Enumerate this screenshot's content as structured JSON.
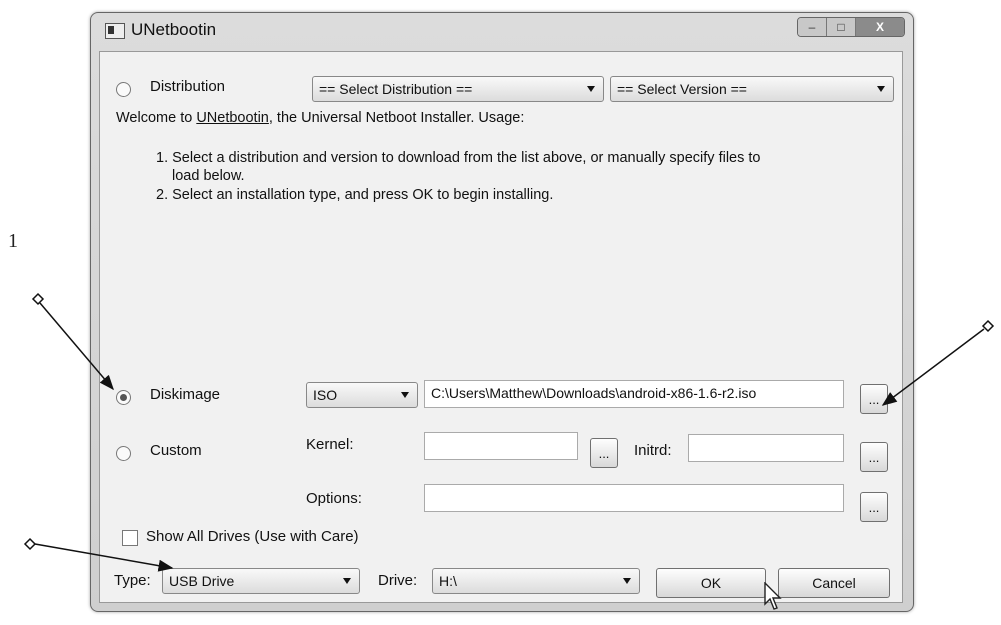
{
  "page_marker": "1",
  "window": {
    "title": "UNetbootin",
    "controls": {
      "minimize": "–",
      "maximize": "□",
      "close": "X"
    }
  },
  "distribution": {
    "radio_label": "Distribution",
    "select_distribution": "== Select Distribution ==",
    "select_version": "== Select Version =="
  },
  "instructions": {
    "welcome_prefix": "Welcome to ",
    "welcome_link": "UNetbootin",
    "welcome_suffix": ", the Universal Netboot Installer. Usage:",
    "step1": "1. Select a distribution and version to download from the list above, or manually specify files to",
    "step1_cont": "load below.",
    "step2": "2. Select an installation type, and press OK to begin installing."
  },
  "diskimage": {
    "radio_label": "Diskimage",
    "type_value": "ISO",
    "path_value": "C:\\Users\\Matthew\\Downloads\\android-x86-1.6-r2.iso",
    "browse_label": "..."
  },
  "custom": {
    "radio_label": "Custom",
    "kernel_label": "Kernel:",
    "kernel_value": "",
    "kernel_browse": "...",
    "initrd_label": "Initrd:",
    "initrd_value": "",
    "initrd_browse": "...",
    "options_label": "Options:",
    "options_value": "",
    "options_browse": "..."
  },
  "show_all_drives": {
    "label": "Show All Drives (Use with Care)"
  },
  "bottom": {
    "type_label": "Type:",
    "type_value": "USB Drive",
    "drive_label": "Drive:",
    "drive_value": "H:\\",
    "ok_label": "OK",
    "cancel_label": "Cancel"
  },
  "icons": [
    "app-icon",
    "chevron-down-icon",
    "mouse-pointer-icon",
    "callout-diamond-icon"
  ],
  "colors": {
    "window_frame": "#cfcfcf",
    "client_bg": "#f1f1f1",
    "close_button": "#8b8b8b"
  }
}
